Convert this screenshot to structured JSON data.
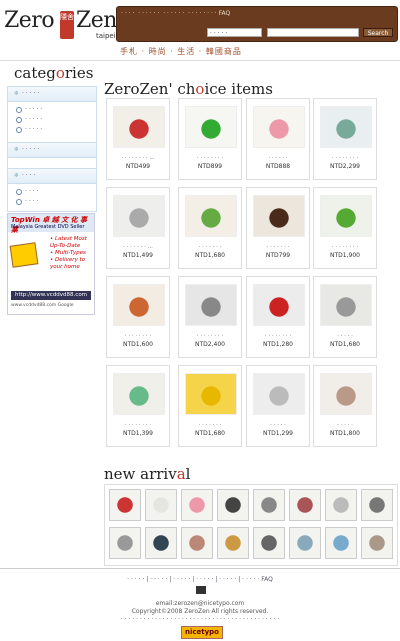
{
  "header": {
    "logo_left": "Zero",
    "logo_seal": "隱舍",
    "logo_right": "Zen",
    "logo_sub": "taipei",
    "nav": [
      "· · · ·",
      "· · · · · ·",
      "· · · · · ·",
      "· · · · · · · · FAQ"
    ],
    "search_select": "· · · · ·",
    "search_button": "Search",
    "tagline": "手札 · 時尚 · 生活 · 韓國商品"
  },
  "sidebar": {
    "title_pre": "categ",
    "title_o": "o",
    "title_post": "ries",
    "groups": [
      {
        "head": "· · · · ·",
        "items": [
          "· · · · ·",
          "· · · · ·",
          "· · · · ·"
        ]
      },
      {
        "head": "· · · · ·",
        "items": []
      },
      {
        "head": "· · · ·",
        "items": [
          "· · · ·",
          "· · · ·"
        ]
      }
    ]
  },
  "ad": {
    "brand": "TopWin 卓 越 文 化 事 業",
    "sub": "Malaysia Greatest DVD Seller",
    "bullets": [
      "• Latest Most",
      "  Up-To-Date",
      "• Multi-Types",
      "• Delivery to",
      "  your home"
    ],
    "url": "http://www.vcddvd88.com",
    "foot": "www.vcddvd88.com      Google"
  },
  "main": {
    "title_pre": "ZeroZen' ch",
    "title_o": "o",
    "title_post": "ice items",
    "products": [
      {
        "name": "· · · · · · · · ...",
        "price": "NTD499",
        "color": "#c33",
        "bg": "#f2efe8"
      },
      {
        "name": "· · · · · · · ·",
        "price": "NTD899",
        "color": "#3a3",
        "bg": "#f6f6f2"
      },
      {
        "name": "· · · · · ·",
        "price": "NTD888",
        "color": "#e9a",
        "bg": "#f7f5f0"
      },
      {
        "name": "· · · · · · · ·",
        "price": "NTD2,299",
        "color": "#7a9",
        "bg": "#e9eef0"
      },
      {
        "name": "· · · · · · · ...",
        "price": "NTD1,499",
        "color": "#aaa",
        "bg": "#eeeeec"
      },
      {
        "name": "· · · · · · ·",
        "price": "NTD1,680",
        "color": "#6a4",
        "bg": "#f3efe6"
      },
      {
        "name": "· · · · · · ·",
        "price": "NTD799",
        "color": "#4a2a1a",
        "bg": "#ece6dc"
      },
      {
        "name": "· · · · · · · ·",
        "price": "NTD1,900",
        "color": "#5a3",
        "bg": "#eef2ea"
      },
      {
        "name": "· · · · · · · ·",
        "price": "NTD1,600",
        "color": "#c63",
        "bg": "#f3ece2"
      },
      {
        "name": "· · · · · · · ·",
        "price": "NTD2,400",
        "color": "#888",
        "bg": "#e6e6e6"
      },
      {
        "name": "· · · · · · · ·",
        "price": "NTD1,280",
        "color": "#c22",
        "bg": "#ececec"
      },
      {
        "name": "· · · · ·",
        "price": "NTD1,680",
        "color": "#999",
        "bg": "#e8e8e4"
      },
      {
        "name": "· · · · · · · ·",
        "price": "NTD1,399",
        "color": "#6b8",
        "bg": "#f0efe9"
      },
      {
        "name": "· · · · · · ·",
        "price": "NTD1,680",
        "color": "#e8b800",
        "bg": "#f6d44a"
      },
      {
        "name": "· · · · ·",
        "price": "NTD1,299",
        "color": "#bbb",
        "bg": "#ededed"
      },
      {
        "name": "· · · · ·",
        "price": "NTD1,800",
        "color": "#b98",
        "bg": "#f1ede8"
      }
    ],
    "new_title_pre": "new arriv",
    "new_title_a": "a",
    "new_title_post": "l",
    "new_arrivals": [
      {
        "color": "#c33"
      },
      {
        "color": "#e6e6e0"
      },
      {
        "color": "#e9a"
      },
      {
        "color": "#444"
      },
      {
        "color": "#888"
      },
      {
        "color": "#a55"
      },
      {
        "color": "#bbb"
      },
      {
        "color": "#777"
      },
      {
        "color": "#999"
      },
      {
        "color": "#345"
      },
      {
        "color": "#b87"
      },
      {
        "color": "#c94"
      },
      {
        "color": "#666"
      },
      {
        "color": "#8ab"
      },
      {
        "color": "#7ac"
      },
      {
        "color": "#a98"
      }
    ]
  },
  "footer": {
    "links": "· · · · · | · · · · · | · · · · · | · · · · · | · · · · · | · · · · · FAQ",
    "email": "email:zerozen@nicetypo.com",
    "copyright": "Copyright©2008 ZeroZen All rights reserved.",
    "notice": "· · · · · · · · · · · · · · · · · · · · · · · · · · · · · · · · · · · · · · · · · ·",
    "badge": "nicetypo"
  }
}
